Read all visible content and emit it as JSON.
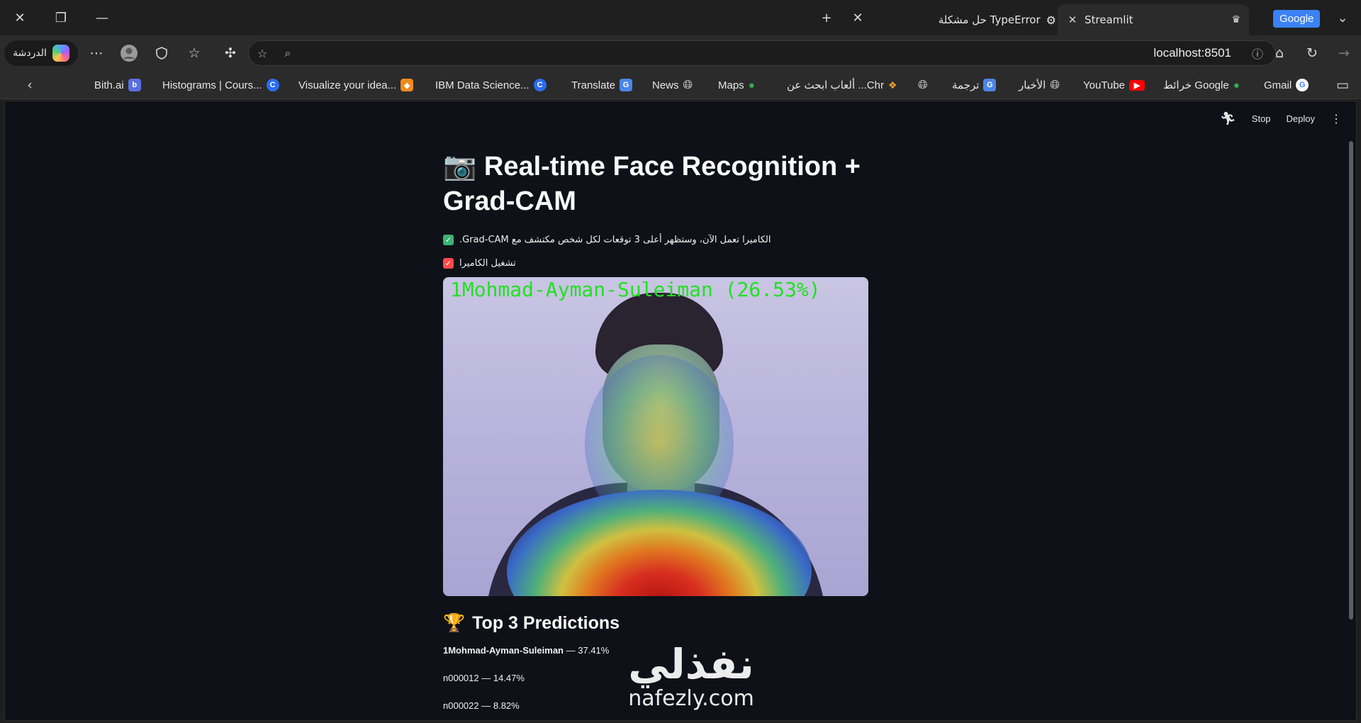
{
  "tabs": {
    "tab1_label": "حل مشكلة TypeError",
    "tab2_label": "Streamlit",
    "google_label": "Google"
  },
  "toolbar": {
    "chat_label": "الدردشة",
    "url": "localhost:8501"
  },
  "bookmarks": [
    {
      "label": "Bith.ai"
    },
    {
      "label": "Histograms | Cours..."
    },
    {
      "label": "Visualize your idea..."
    },
    {
      "label": "IBM Data Science..."
    },
    {
      "label": "Translate"
    },
    {
      "label": "News"
    },
    {
      "label": "Maps"
    },
    {
      "label": "ألعاب ابحث عن ...Chr"
    },
    {
      "label": "ترجمة"
    },
    {
      "label": "الأخبار"
    },
    {
      "label": "YouTube"
    },
    {
      "label": "خرائط Google"
    },
    {
      "label": "Gmail"
    }
  ],
  "app_header": {
    "stop_label": "Stop",
    "deploy_label": "Deploy"
  },
  "main": {
    "title": "📷 Real-time Face Recognition + Grad-CAM",
    "info": "الكاميرا تعمل الآن، وستظهر أعلى 3 توقعات لكل شخص مكتشف مع Grad-CAM.",
    "checkbox_label": "تشغيل الكاميرا",
    "overlay_text": "1Mohmad-Ayman-Suleiman (26.53%)",
    "section_title": "Top 3 Predictions",
    "predictions": [
      {
        "name": "1Mohmad-Ayman-Suleiman",
        "value": "37.41%"
      },
      {
        "name": "n000012",
        "value": "14.47%"
      },
      {
        "name": "n000022",
        "value": "8.82%"
      }
    ]
  },
  "watermark": {
    "arabic": "نفذلي",
    "latin": "nafezly.com"
  }
}
